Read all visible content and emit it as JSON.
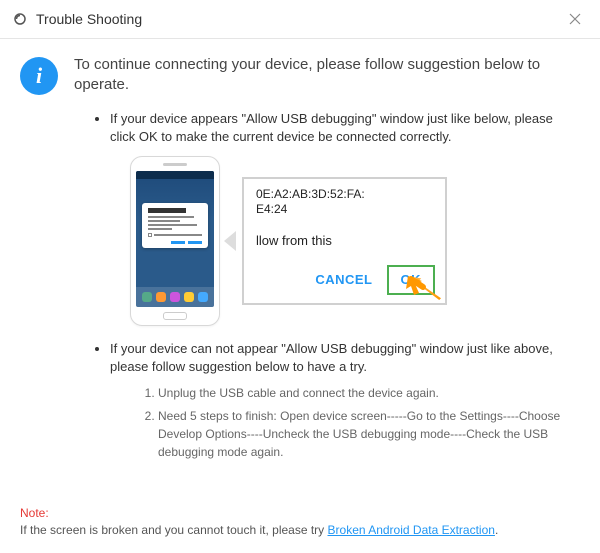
{
  "titlebar": {
    "title": "Trouble Shooting"
  },
  "intro": "To continue connecting your device, please follow suggestion below to operate.",
  "bullets": {
    "first": "If your device appears \"Allow USB debugging\" window just like below, please click OK to make the current device  be connected correctly.",
    "second": "If your device can not appear \"Allow USB debugging\" window just like above, please follow suggestion below to have a try."
  },
  "zoom": {
    "mac_line1": "0E:A2:AB:3D:52:FA:",
    "mac_line2": "E4:24",
    "mid_text": "llow from this",
    "cancel": "CANCEL",
    "ok": "OK"
  },
  "steps": {
    "one": "Unplug the USB cable and connect the device again.",
    "two": "Need 5 steps to finish: Open device screen-----Go to the Settings----Choose Develop Options----Uncheck the USB debugging mode----Check the USB debugging mode again."
  },
  "note": {
    "label": "Note:",
    "text_before": "If the screen is broken and you cannot touch it, please try ",
    "link": "Broken Android Data Extraction",
    "text_after": "."
  }
}
